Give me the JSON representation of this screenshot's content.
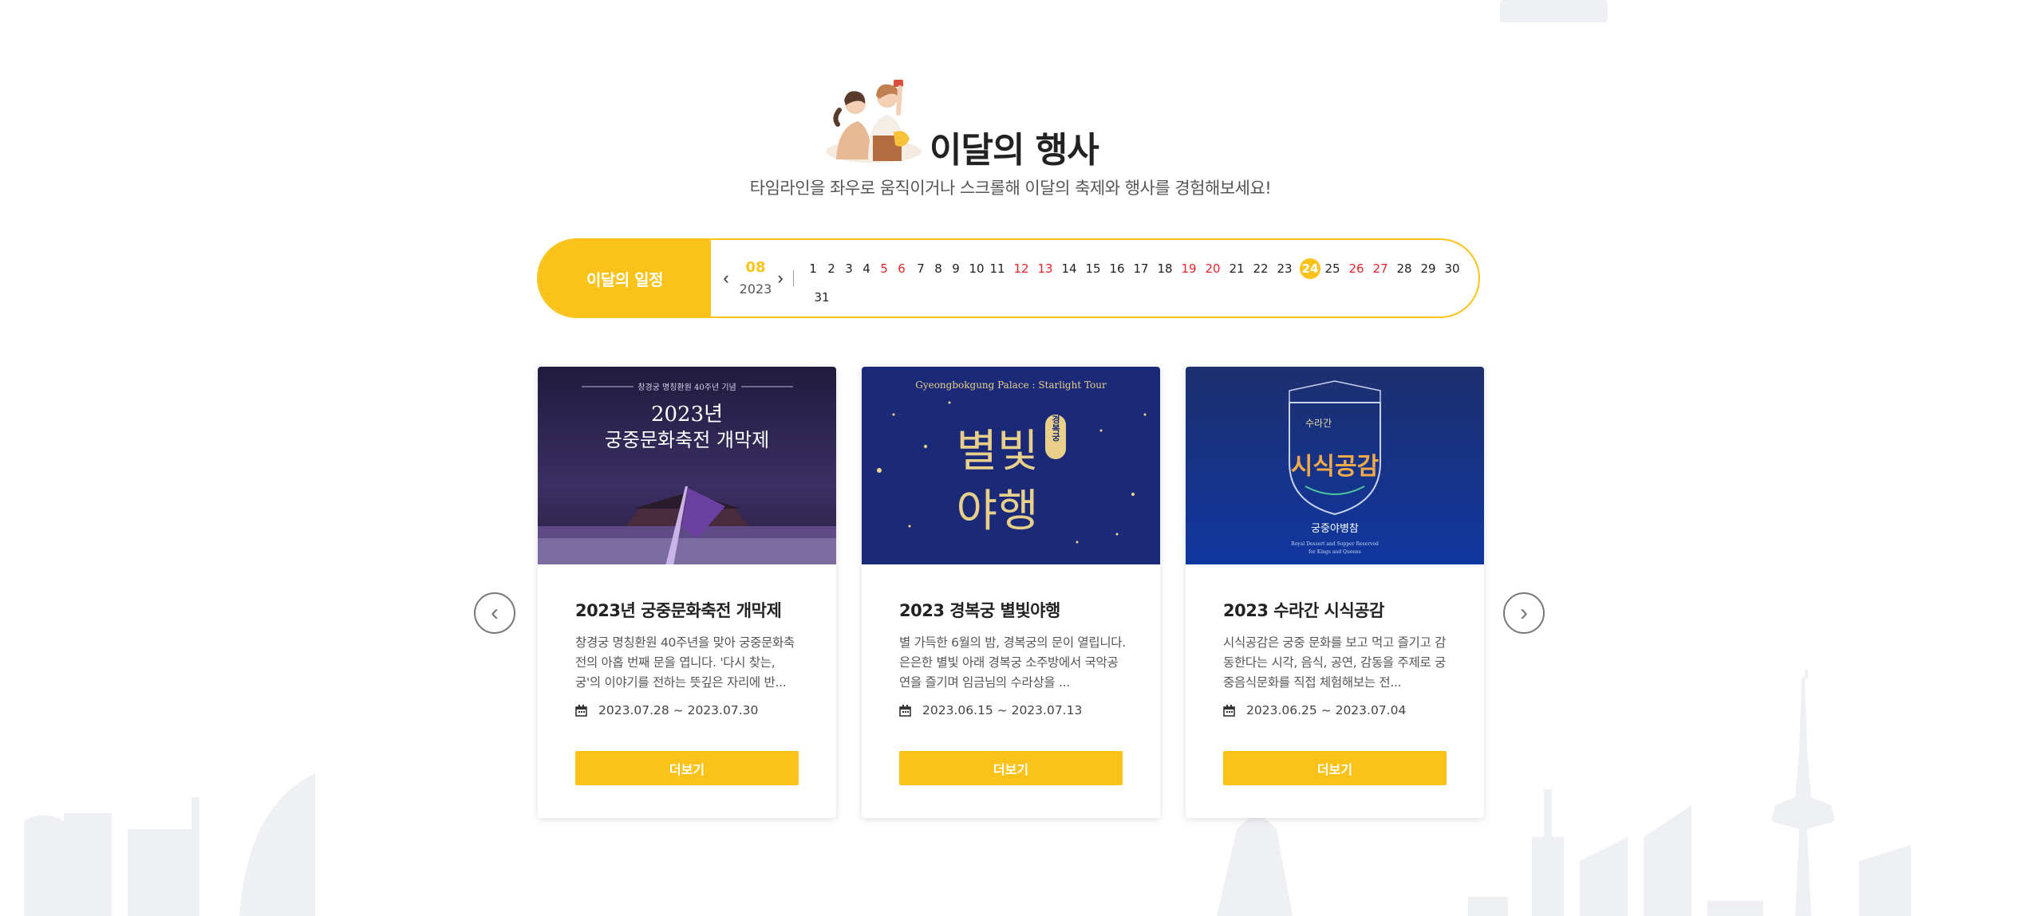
{
  "section": {
    "title": "이달의 행사",
    "subtitle": "타임라인을 좌우로 움직이거나 스크롤해 이달의 축제와 행사를 경험해보세요!"
  },
  "schedule": {
    "label": "이달의 일정",
    "month": "08",
    "year": "2023",
    "days": [
      {
        "d": "1"
      },
      {
        "d": "2"
      },
      {
        "d": "3"
      },
      {
        "d": "4"
      },
      {
        "d": "5",
        "red": true
      },
      {
        "d": "6",
        "red": true
      },
      {
        "d": "7"
      },
      {
        "d": "8"
      },
      {
        "d": "9"
      },
      {
        "d": "10"
      },
      {
        "d": "11"
      },
      {
        "d": "12",
        "red": true
      },
      {
        "d": "13",
        "red": true
      },
      {
        "d": "14"
      },
      {
        "d": "15"
      },
      {
        "d": "16"
      },
      {
        "d": "17"
      },
      {
        "d": "18"
      },
      {
        "d": "19",
        "red": true
      },
      {
        "d": "20",
        "red": true
      },
      {
        "d": "21"
      },
      {
        "d": "22"
      },
      {
        "d": "23"
      },
      {
        "d": "24",
        "today": true
      },
      {
        "d": "25"
      },
      {
        "d": "26",
        "red": true
      },
      {
        "d": "27",
        "red": true
      },
      {
        "d": "28"
      },
      {
        "d": "29"
      },
      {
        "d": "30"
      },
      {
        "d": "31"
      }
    ]
  },
  "cards": [
    {
      "title": "2023년 궁중문화축전 개막제",
      "desc": "창경궁 명칭환원 40주년을 맞아 궁중문화축전의 아홉 번째 문을 엽니다. '다시 찾는, 궁'의 이야기를 전하는 뜻깊은 자리에 반...",
      "date": "2023.07.28 ~ 2023.07.30",
      "more": "더보기",
      "poster_sub": "창경궁 명칭환원 40주년 기념",
      "poster_line1": "2023년",
      "poster_line2": "궁중문화축전 개막제"
    },
    {
      "title": "2023 경복궁 별빛야행",
      "desc": "별 가득한 6월의 밤, 경복궁의 문이 열립니다. 은은한 별빛 아래 경복궁 소주방에서 국악공연을 즐기며 임금님의 수라상을 ...",
      "date": "2023.06.15 ~ 2023.07.13",
      "more": "더보기",
      "poster_sub": "Gyeongbokgung Palace : Starlight Tour",
      "poster_line1": "별빛",
      "poster_line2": "야행",
      "poster_badge": "경복궁"
    },
    {
      "title": "2023 수라간 시식공감",
      "desc": "시식공감은 궁중 문화를 보고 먹고 즐기고 감동한다는 시각, 음식, 공연, 감동을 주제로 궁중음식문화를 직접 체험해보는 전...",
      "date": "2023.06.25 ~ 2023.07.04",
      "more": "더보기",
      "poster_line1": "궁중야병참",
      "poster_line2": "Royal Dessert and Supper Reserved",
      "poster_line3": "for Kings and Queens",
      "poster_emblem": "수라간",
      "poster_emblem2": "시식공감"
    }
  ],
  "colors": {
    "accent": "#fbc31a",
    "holiday": "#e8242a"
  }
}
